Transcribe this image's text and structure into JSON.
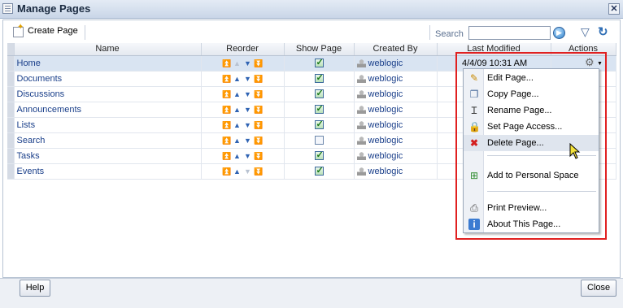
{
  "window": {
    "title": "Manage Pages"
  },
  "toolbar": {
    "create_label": "Create Page",
    "search_label": "Search",
    "search_value": ""
  },
  "columns": [
    "Name",
    "Reorder",
    "Show Page",
    "Created By",
    "Last Modified",
    "Actions"
  ],
  "rows": [
    {
      "name": "Home",
      "show": true,
      "created_by": "weblogic",
      "modified": "4/4/09 10:31 AM",
      "selected": true
    },
    {
      "name": "Documents",
      "show": true,
      "created_by": "weblogic"
    },
    {
      "name": "Discussions",
      "show": true,
      "created_by": "weblogic"
    },
    {
      "name": "Announcements",
      "show": true,
      "created_by": "weblogic"
    },
    {
      "name": "Lists",
      "show": true,
      "created_by": "weblogic"
    },
    {
      "name": "Search",
      "show": false,
      "created_by": "weblogic"
    },
    {
      "name": "Tasks",
      "show": true,
      "created_by": "weblogic"
    },
    {
      "name": "Events",
      "show": true,
      "created_by": "weblogic"
    }
  ],
  "menu": {
    "items": [
      {
        "label": "Edit Page...",
        "icon": "pencil-icon"
      },
      {
        "label": "Copy Page...",
        "icon": "copy-icon"
      },
      {
        "label": "Rename Page...",
        "icon": "rename-icon"
      },
      {
        "label": "Set Page Access...",
        "icon": "lock-icon"
      },
      {
        "label": "Delete Page...",
        "icon": "delete-icon"
      },
      {
        "label": "Add to Personal Space",
        "icon": "add-space-icon"
      },
      {
        "label": "Print Preview...",
        "icon": "printer-icon"
      },
      {
        "label": "About This Page...",
        "icon": "info-icon"
      }
    ]
  },
  "footer": {
    "help_label": "Help",
    "close_label": "Close"
  },
  "colors": {
    "accent": "#1a3f8a",
    "highlight_box": "#e02020",
    "selected_row": "#d9e4f2"
  }
}
